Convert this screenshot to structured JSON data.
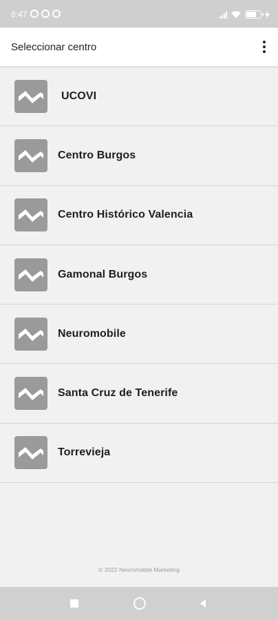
{
  "status_bar": {
    "time": "8:47",
    "left_icons": [
      "alarm-icon",
      "app-notification-icon",
      "app-notification-icon"
    ],
    "right_icons": [
      "signal-icon",
      "wifi-icon",
      "battery-icon",
      "charging-icon"
    ],
    "color": "#cfcfd0"
  },
  "app_bar": {
    "title": "Seleccionar centro",
    "menu_icon": "more-vert-icon"
  },
  "centers": [
    {
      "label": "UCOVI",
      "icon": "image-placeholder-icon"
    },
    {
      "label": "Centro Burgos",
      "icon": "image-placeholder-icon"
    },
    {
      "label": "Centro Histórico Valencia",
      "icon": "image-placeholder-icon"
    },
    {
      "label": "Gamonal Burgos",
      "icon": "image-placeholder-icon"
    },
    {
      "label": "Neuromobile",
      "icon": "image-placeholder-icon"
    },
    {
      "label": "Santa Cruz de Tenerife",
      "icon": "image-placeholder-icon"
    },
    {
      "label": "Torrevieja",
      "icon": "image-placeholder-icon"
    }
  ],
  "footer": {
    "copyright": "© 2022 Neuromobile Marketing"
  },
  "nav_bar": {
    "buttons": [
      "recents-icon",
      "home-icon",
      "back-icon"
    ]
  },
  "colors": {
    "background": "#f1f1f2",
    "app_bar": "#ffffff",
    "thumbnail": "#9a9a9a",
    "text": "#1e1e1e",
    "divider": "#d4d4d4"
  }
}
